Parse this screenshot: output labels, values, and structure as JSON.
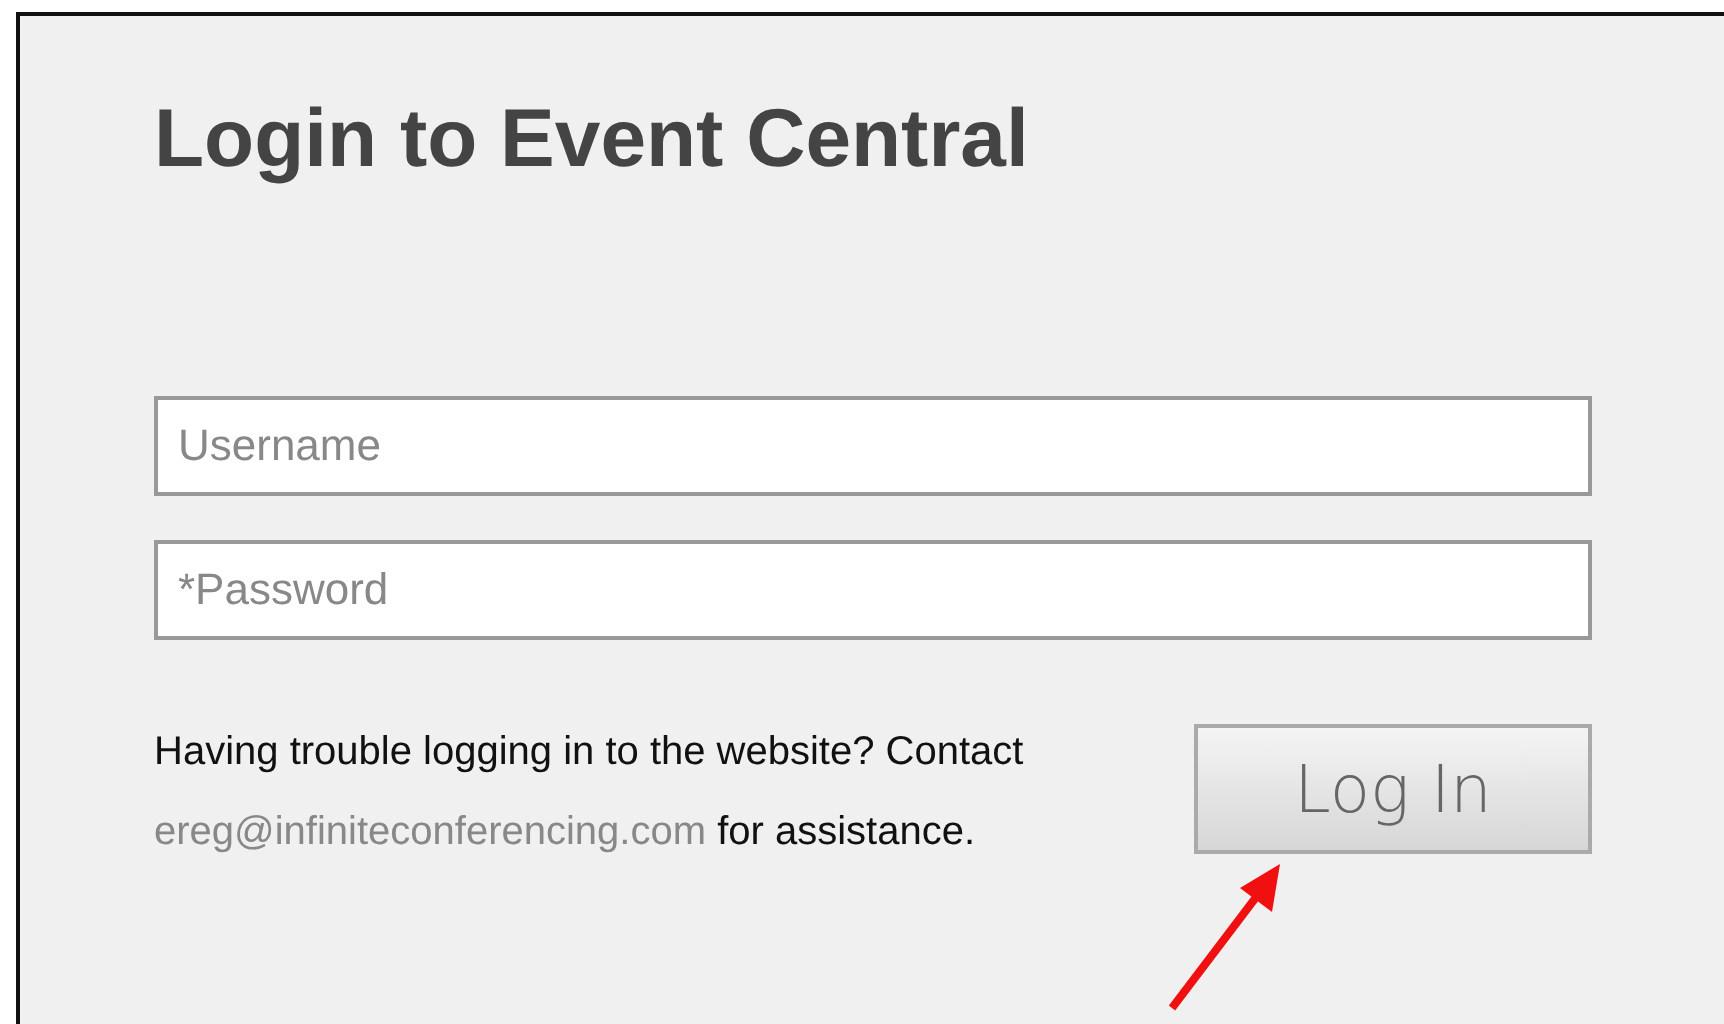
{
  "title": "Login to Event Central",
  "fields": [
    {
      "placeholder": "Username"
    },
    {
      "placeholder": "*Password"
    }
  ],
  "help": {
    "before": "Having trouble logging in to the website? Contact",
    "link": "ereg@infiniteconferencing.com",
    "after": "for assistance."
  },
  "button": "Log In"
}
